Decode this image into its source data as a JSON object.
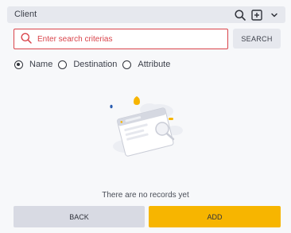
{
  "header": {
    "title": "Client",
    "icons": [
      "search-icon",
      "add-square-icon",
      "chevron-down-icon"
    ]
  },
  "search": {
    "placeholder": "Enter search criterias",
    "value": "",
    "button_label": "SEARCH"
  },
  "filter_options": {
    "selected": "Name",
    "options": [
      "Name",
      "Destination",
      "Attribute"
    ]
  },
  "empty_state": {
    "message": "There are no records yet",
    "illustration": "empty-browser-illustration"
  },
  "actions": {
    "back_label": "BACK",
    "add_label": "ADD"
  },
  "colors": {
    "accent": "#f7b500",
    "error_border": "#d9434a",
    "secondary_button": "#d8dae3"
  }
}
